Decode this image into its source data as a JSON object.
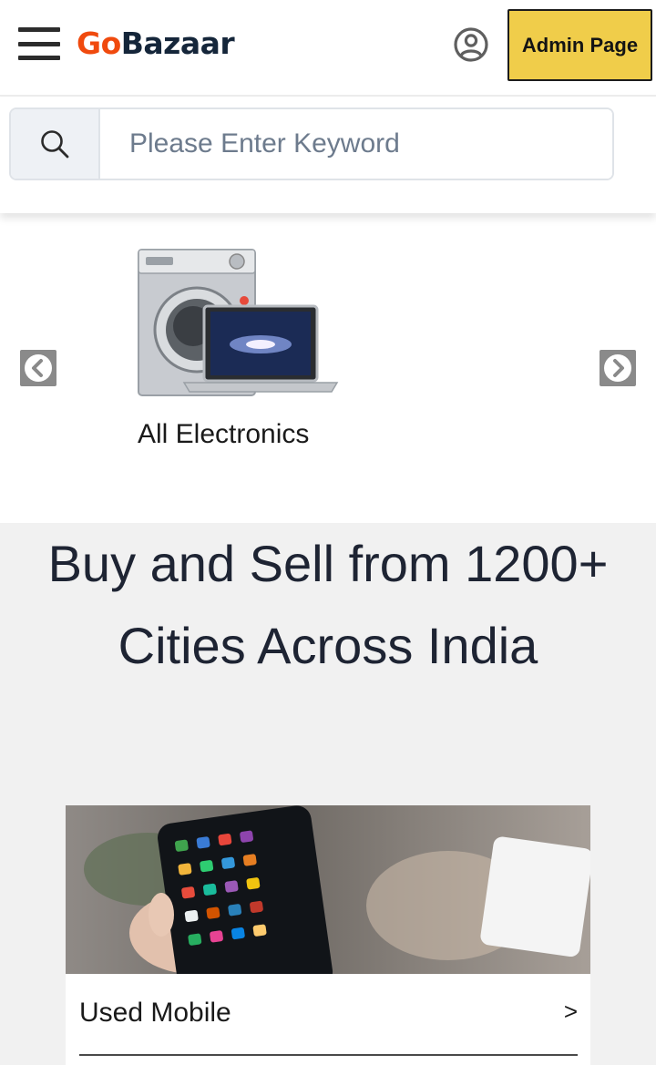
{
  "header": {
    "logo_go": "Go",
    "logo_bazaar": "Bazaar",
    "admin_button": "Admin Page",
    "icons": [
      "menu-icon",
      "account-icon"
    ]
  },
  "search": {
    "placeholder": "Please Enter Keyword",
    "icon": "search-icon"
  },
  "carousel": {
    "current_caption": "All Electronics",
    "prev_icon": "chevron-left-icon",
    "next_icon": "chevron-right-icon"
  },
  "promo": {
    "heading": "Buy and Sell from 1200+ Cities Across India",
    "categories": [
      {
        "label": "Used Mobile",
        "arrow": ">"
      }
    ]
  },
  "colors": {
    "brand_orange": "#f04a0e",
    "brand_navy": "#15263a",
    "admin_yellow": "#f0cd4a",
    "promo_bg": "#f1f1f1"
  }
}
